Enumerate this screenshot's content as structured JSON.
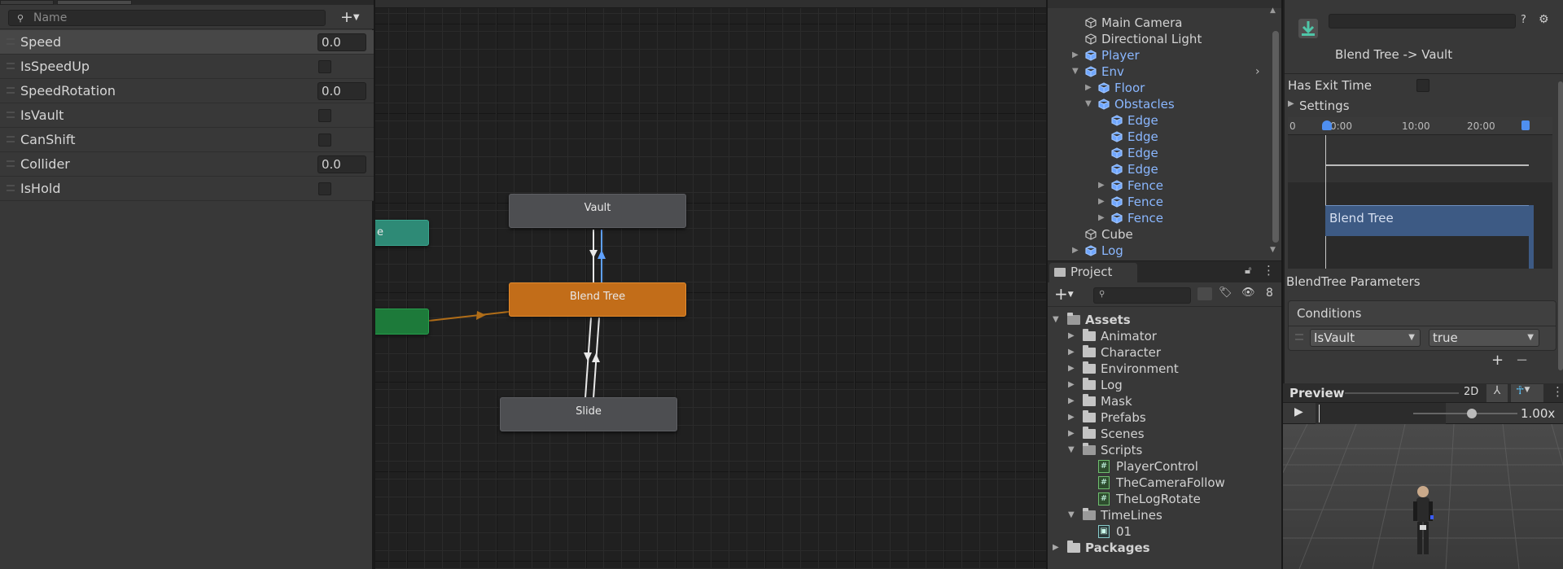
{
  "parameters_panel": {
    "search_placeholder": "Name",
    "add_label": "+",
    "rows": [
      {
        "name": "Speed",
        "type": "float",
        "value": "0.0"
      },
      {
        "name": "IsSpeedUp",
        "type": "bool"
      },
      {
        "name": "SpeedRotation",
        "type": "float",
        "value": "0.0"
      },
      {
        "name": "IsVault",
        "type": "bool"
      },
      {
        "name": "CanShift",
        "type": "bool"
      },
      {
        "name": "Collider",
        "type": "float",
        "value": "0.0"
      },
      {
        "name": "IsHold",
        "type": "bool"
      }
    ]
  },
  "graph": {
    "states": {
      "vault": "Vault",
      "blend_tree": "Blend Tree",
      "slide": "Slide",
      "partial_teal": "e"
    }
  },
  "hierarchy": {
    "rows": [
      {
        "label": "Main Camera",
        "color": "white"
      },
      {
        "label": "Directional Light",
        "color": "white"
      },
      {
        "label": "Player",
        "color": "blue",
        "expand": "closed"
      },
      {
        "label": "Env",
        "color": "blue",
        "expand": "open"
      },
      {
        "label": "Floor",
        "color": "blue",
        "expand": "closed"
      },
      {
        "label": "Obstacles",
        "color": "blue",
        "expand": "open"
      },
      {
        "label": "Edge",
        "color": "blue"
      },
      {
        "label": "Edge",
        "color": "blue"
      },
      {
        "label": "Edge",
        "color": "blue"
      },
      {
        "label": "Edge",
        "color": "blue"
      },
      {
        "label": "Fence",
        "color": "blue",
        "expand": "closed"
      },
      {
        "label": "Fence",
        "color": "blue",
        "expand": "closed"
      },
      {
        "label": "Fence",
        "color": "blue",
        "expand": "closed"
      },
      {
        "label": "Cube",
        "color": "white"
      },
      {
        "label": "Log",
        "color": "blue",
        "expand": "closed"
      }
    ]
  },
  "project": {
    "tab_label": "Project",
    "hidden_count": "8",
    "tree": [
      {
        "label": "Assets",
        "kind": "folder-open",
        "bold": true
      },
      {
        "label": "Animator",
        "kind": "folder"
      },
      {
        "label": "Character",
        "kind": "folder"
      },
      {
        "label": "Environment",
        "kind": "folder"
      },
      {
        "label": "Log",
        "kind": "folder"
      },
      {
        "label": "Mask",
        "kind": "folder"
      },
      {
        "label": "Prefabs",
        "kind": "folder"
      },
      {
        "label": "Scenes",
        "kind": "folder"
      },
      {
        "label": "Scripts",
        "kind": "folder-open"
      },
      {
        "label": "PlayerControl",
        "kind": "script"
      },
      {
        "label": "TheCameraFollow",
        "kind": "script"
      },
      {
        "label": "TheLogRotate",
        "kind": "script"
      },
      {
        "label": "TimeLines",
        "kind": "folder-open"
      },
      {
        "label": "01",
        "kind": "timeline"
      },
      {
        "label": "Packages",
        "kind": "folder",
        "bold": true
      }
    ]
  },
  "inspector": {
    "transition_title": "Blend Tree -> Vault",
    "has_exit_time": "Has Exit Time",
    "settings": "Settings",
    "ruler_ticks": [
      "0",
      "0:00",
      "10:00",
      "20:00"
    ],
    "blend_tree_clip": "Blend Tree",
    "blendtree_params": "BlendTree Parameters",
    "conditions": "Conditions",
    "condition_param": "IsVault",
    "condition_value": "true",
    "plus": "+",
    "minus": "−"
  },
  "preview": {
    "label": "Preview",
    "mode_2d": "2D",
    "speed": "1.00x",
    "speed_value": 1.0
  },
  "colors": {
    "orange_state": "#c26d19",
    "grey_state": "#4d4e51",
    "teal_state": "#2e8a76",
    "green_state": "#1d7a3a",
    "link_blue": "#8ab7ff"
  }
}
